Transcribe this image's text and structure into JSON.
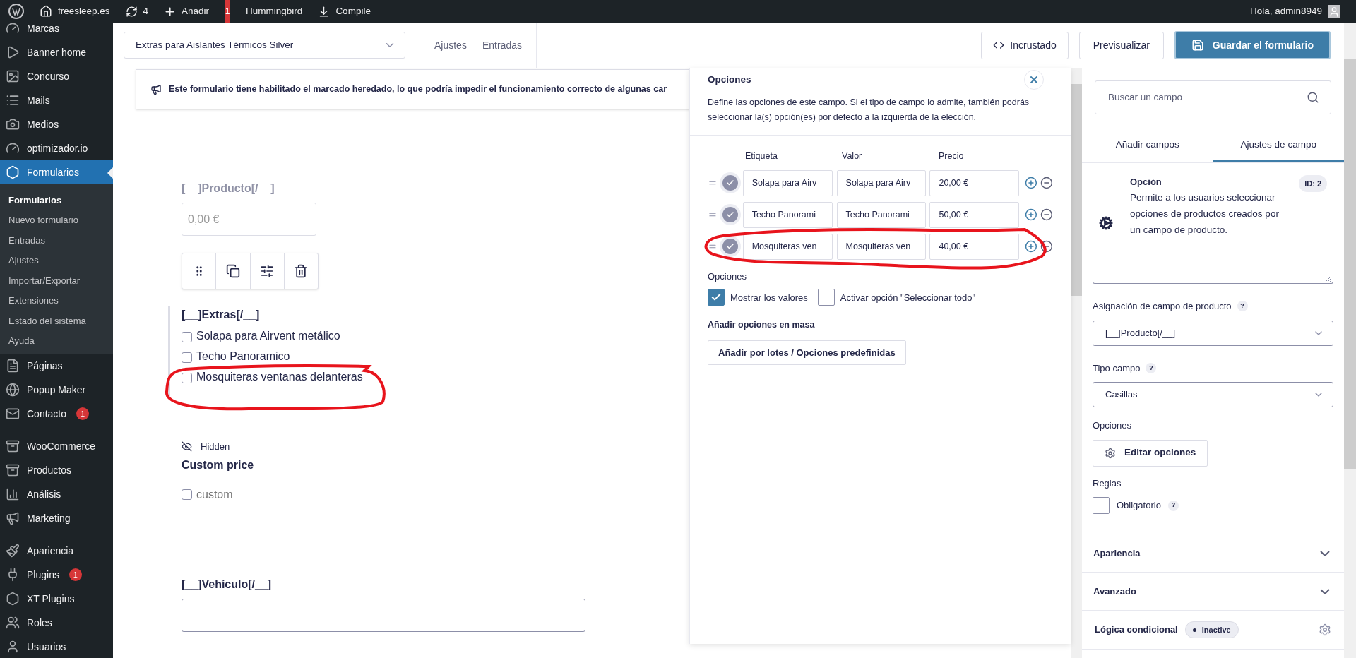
{
  "admin_bar": {
    "items": [
      {
        "kind": "logo"
      },
      {
        "kind": "site",
        "label": "freesleep.es"
      },
      {
        "kind": "updates",
        "label": "4"
      },
      {
        "kind": "new",
        "label": "Añadir"
      },
      {
        "kind": "alert",
        "label": "1"
      },
      {
        "kind": "plain",
        "label": "Hummingbird"
      },
      {
        "kind": "compile",
        "label": "Compile"
      }
    ],
    "greeting": "Hola, admin8949"
  },
  "sidebar": {
    "groups": [
      [
        {
          "label": "Marcas",
          "selected": false
        },
        {
          "label": "Banner home",
          "selected": false
        },
        {
          "label": "Concurso",
          "selected": false
        },
        {
          "label": "Mails",
          "selected": false
        },
        {
          "label": "Medios",
          "selected": false
        },
        {
          "label": "optimizador.io",
          "selected": false
        },
        {
          "label": "Formularios",
          "selected": true,
          "submenu": [
            {
              "label": "Formularios",
              "selected": true
            },
            {
              "label": "Nuevo formulario",
              "selected": false
            },
            {
              "label": "Entradas",
              "selected": false
            },
            {
              "label": "Ajustes",
              "selected": false
            },
            {
              "label": "Importar/Exportar",
              "selected": false
            },
            {
              "label": "Extensiones",
              "selected": false
            },
            {
              "label": "Estado del sistema",
              "selected": false
            },
            {
              "label": "Ayuda",
              "selected": false
            }
          ]
        },
        {
          "label": "Páginas",
          "selected": false
        },
        {
          "label": "Popup Maker",
          "selected": false
        },
        {
          "label": "Contacto",
          "selected": false,
          "badge": "1"
        }
      ],
      [
        {
          "label": "WooCommerce",
          "selected": false
        },
        {
          "label": "Productos",
          "selected": false
        },
        {
          "label": "Análisis",
          "selected": false
        },
        {
          "label": "Marketing",
          "selected": false
        }
      ],
      [
        {
          "label": "Apariencia",
          "selected": false
        },
        {
          "label": "Plugins",
          "selected": false,
          "badge": "1"
        },
        {
          "label": "XT Plugins",
          "selected": false
        },
        {
          "label": "Roles",
          "selected": false
        },
        {
          "label": "Usuarios",
          "selected": false
        }
      ]
    ]
  },
  "form_header": {
    "form_select": "Extras para Aislantes Térmicos Silver",
    "tabs": [
      {
        "label": "Ajustes",
        "selected": false
      },
      {
        "label": "Entradas",
        "selected": false
      }
    ],
    "buttons": [
      {
        "kind": "embed",
        "label": "Incrustado"
      },
      {
        "kind": "preview",
        "label": "Previsualizar"
      },
      {
        "kind": "save",
        "label": "Guardar el formulario"
      }
    ]
  },
  "notice": "Este formulario tiene habilitado el marcado heredado, lo que podría impedir el funcionamiento correcto de algunas car",
  "canvas": {
    "fields": [
      {
        "kind": "price",
        "label": "[__]Producto[/__]",
        "placeholder": "0,00 €",
        "dimmed": true,
        "selected": false
      },
      {
        "kind": "checkboxes",
        "label": "[__]Extras[/__]",
        "dimmed": false,
        "selected": true,
        "options": [
          {
            "label": "Solapa para Airvent metálico",
            "checked": false
          },
          {
            "label": "Techo Panoramico",
            "checked": false
          },
          {
            "label": "Mosquiteras ventanas delanteras",
            "checked": false
          }
        ]
      },
      {
        "kind": "checkboxes",
        "label": "Custom price",
        "hidden_badge": "Hidden",
        "dimmed": false,
        "selected": false,
        "options": [
          {
            "label": "custom",
            "checked": false
          }
        ]
      },
      {
        "kind": "text",
        "label": "[__]Vehículo[/__]",
        "dimmed": false,
        "selected": false
      }
    ]
  },
  "options_panel": {
    "title": "Opciones",
    "description": "Define las opciones de este campo. Si el tipo de campo lo admite, también podrás seleccionar la(s) opción(es) por defecto a la izquierda de la elección.",
    "columns": [
      "Etiqueta",
      "Valor",
      "Precio"
    ],
    "rows": [
      {
        "label": "Solapa para Airv",
        "value": "Solapa para Airv",
        "price": "20,00 €",
        "default": false
      },
      {
        "label": "Techo Panorami",
        "value": "Techo Panorami",
        "price": "50,00 €",
        "default": false
      },
      {
        "label": "Mosquiteras ven",
        "value": "Mosquiteras ven",
        "price": "40,00 €",
        "default": false
      }
    ],
    "settings_title": "Opciones",
    "settings": [
      {
        "label": "Mostrar los valores",
        "checked": true
      },
      {
        "label": "Activar opción \"Seleccionar todo\"",
        "checked": false
      }
    ],
    "bulk_title": "Añadir opciones en masa",
    "bulk_button": "Añadir por lotes / Opciones predefinidas"
  },
  "right_panel": {
    "search": {
      "placeholder": "Buscar un campo"
    },
    "tabs": [
      {
        "label": "Añadir campos",
        "selected": false
      },
      {
        "label": "Ajustes de campo",
        "selected": true
      }
    ],
    "field_info": {
      "title": "Opción",
      "id_badge": "ID: 2",
      "description": "Permite a los usuarios seleccionar opciones de productos creados por un campo de producto."
    },
    "product_field": {
      "label": "Asignación de campo de producto",
      "help": "?",
      "value": "[__]Producto[/__]"
    },
    "field_type": {
      "label": "Tipo campo",
      "help": "?",
      "value": "Casillas"
    },
    "options_label": "Opciones",
    "edit_button": "Editar opciones",
    "rules_label": "Reglas",
    "required": {
      "label": "Obligatorio",
      "help": "?",
      "checked": false
    },
    "sections": [
      {
        "label": "Apariencia",
        "expanded": false
      },
      {
        "label": "Avanzado",
        "expanded": false
      }
    ],
    "conditional": {
      "label": "Lógica condicional",
      "status": "Inactive"
    }
  }
}
